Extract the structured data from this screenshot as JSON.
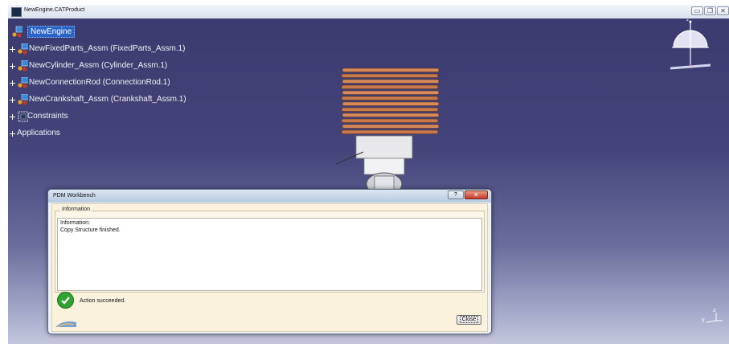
{
  "window": {
    "title": "NewEngine.CATProduct",
    "controls": [
      "▭",
      "❐",
      "✕"
    ]
  },
  "tree": {
    "root": "NewEngine",
    "items": [
      "NewFixedParts_Assm (FixedParts_Assm.1)",
      "NewCylinder_Assm (Cylinder_Assm.1)",
      "NewConnectionRod (ConnectionRod.1)",
      "NewCrankshaft_Assm (Crankshaft_Assm.1)",
      "Constraints",
      "Applications"
    ]
  },
  "compass": {
    "axis_label": "z"
  },
  "axis_triad": {
    "label_y": "y",
    "label_z": "z"
  },
  "dialog": {
    "title": "PDM Workbench",
    "help_glyph": "?",
    "close_glyph": "✕",
    "group_label": "Information",
    "message_line1": "Information:",
    "message_line2": "Copy Structure finished.",
    "status_text": "Action succeeded.",
    "close_button": "Close"
  },
  "colors": {
    "viewport_top": "#3b3b70",
    "viewport_bottom": "#c3c6dd",
    "selection": "#2a64c9",
    "success": "#2fa32f"
  }
}
